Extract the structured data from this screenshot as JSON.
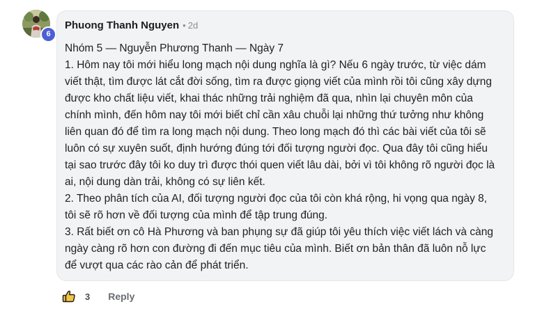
{
  "comment": {
    "avatar": {
      "badge": "6"
    },
    "author": "Phuong Thanh Nguyen",
    "separator": "•",
    "time": "2d",
    "lines": [
      "Nhóm 5 — Nguyễn Phương Thanh — Ngày 7",
      "1. Hôm nay tôi mới hiểu long mạch nội dung nghĩa là gì? Nếu 6 ngày trước, từ việc dám",
      "viết thật, tìm được lát cắt đời sống, tìm ra được giọng viết của mình rồi tôi cũng xây dựng",
      "được kho chất liệu viết, khai thác những trải nghiệm đã qua, nhìn lại chuyên môn của",
      "chính mình, đến hôm nay tôi mới biết chỉ cần xâu chuỗi lại những thứ tưởng như không",
      "liên quan đó để tìm ra long mạch nội dung. Theo long mạch đó thì các bài viết của tôi sẽ",
      "luôn có sự xuyên suốt, định hướng đúng tới đối tượng người đọc. Qua đây tôi cũng hiểu",
      "tại sao trước đây tôi ko duy trì được thói quen viết lâu dài, bởi vì tôi không rõ người đọc là",
      "ai, nội dung dàn trải, không có sự liên kết.",
      "2. Theo phân tích của AI, đối tượng người đọc của tôi còn khá rộng, hi vọng qua ngày 8,",
      "tôi sẽ rõ hơn về đối tượng của mình để tập trung đúng.",
      "3. Rất biết ơn cô Hà Phương và ban phụng sự đã giúp tôi yêu thích việc viết lách và càng",
      "ngày càng rõ hơn con đường đi đến mục tiêu của mình. Biết ơn bản thân đã luôn nỗ lực",
      "để vượt qua các rào cản để phát triển."
    ]
  },
  "actions": {
    "like_icon": "thumbs-up-icon",
    "like_count": "3",
    "reply_label": "Reply"
  },
  "colors": {
    "bubble_bg": "#f2f3f5",
    "badge": "#4c5fd5",
    "meta_text": "#8a8d93"
  }
}
